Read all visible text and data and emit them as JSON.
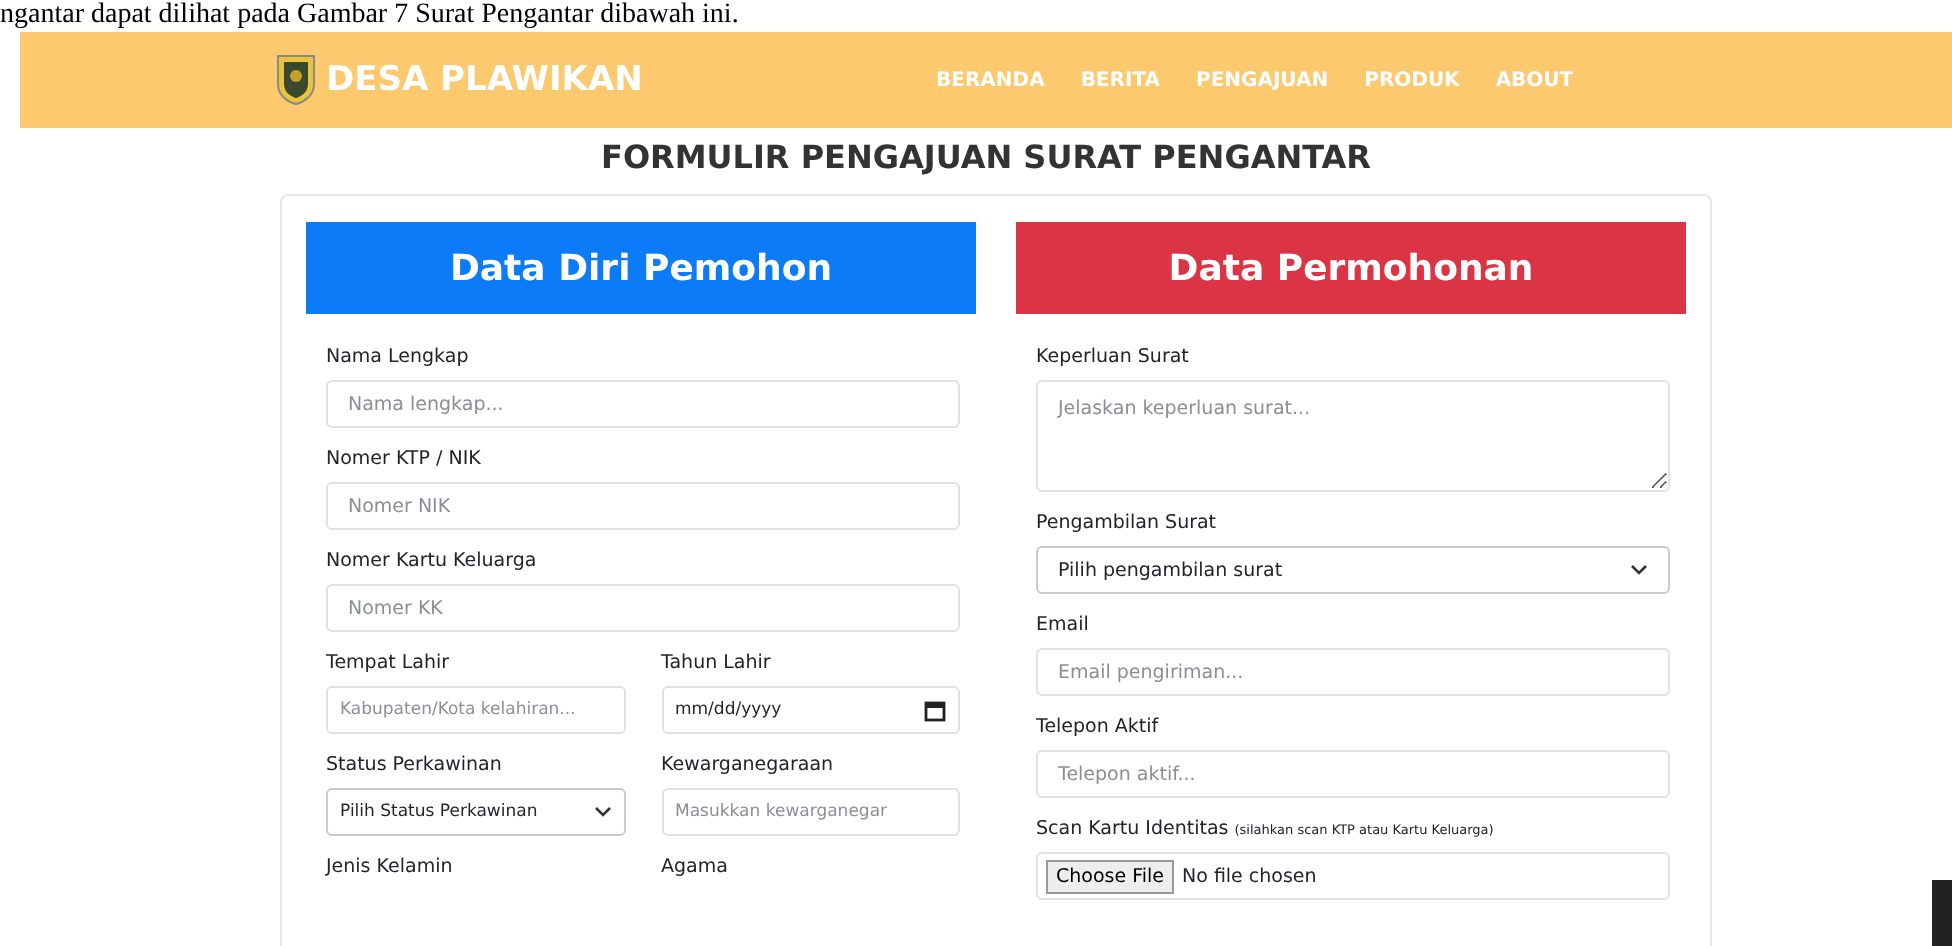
{
  "doc_caption": "ngantar dapat dilihat pada Gambar 7 Surat Pengantar dibawah ini.",
  "navbar": {
    "brand": "DESA PLAWIKAN",
    "links": [
      "BERANDA",
      "BERITA",
      "PENGAJUAN",
      "PRODUK",
      "ABOUT"
    ]
  },
  "title": "FORMULIR PENGAJUAN SURAT PENGANTAR",
  "left_panel": {
    "heading": "Data Diri Pemohon",
    "rows": [
      [
        {
          "kind": "input",
          "label": "Nama Lengkap",
          "placeholder": "Nama lengkap..."
        }
      ],
      [
        {
          "kind": "input",
          "label": "Nomer KTP / NIK",
          "placeholder": "Nomer NIK"
        }
      ],
      [
        {
          "kind": "input",
          "label": "Nomer Kartu Keluarga",
          "placeholder": "Nomer KK"
        }
      ],
      [
        {
          "kind": "input",
          "label": "Tempat Lahir",
          "placeholder": "Kabupaten/Kota kelahiran..."
        },
        {
          "kind": "date",
          "label": "Tahun Lahir",
          "placeholder": "mm/dd/yyyy"
        }
      ],
      [
        {
          "kind": "select",
          "label": "Status Perkawinan",
          "value": "Pilih Status Perkawinan"
        },
        {
          "kind": "input",
          "label": "Kewarganegaraan",
          "placeholder": "Masukkan kewarganegar"
        }
      ],
      [
        {
          "kind": "label",
          "label": "Jenis Kelamin"
        },
        {
          "kind": "label",
          "label": "Agama"
        }
      ]
    ]
  },
  "right_panel": {
    "heading": "Data Permohonan",
    "rows": [
      [
        {
          "kind": "textarea",
          "label": "Keperluan Surat",
          "placeholder": "Jelaskan keperluan surat..."
        }
      ],
      [
        {
          "kind": "select",
          "label": "Pengambilan Surat",
          "value": "Pilih pengambilan surat"
        }
      ],
      [
        {
          "kind": "input",
          "label": "Email",
          "placeholder": "Email pengiriman..."
        }
      ],
      [
        {
          "kind": "input",
          "label": "Telepon Aktif",
          "placeholder": "Telepon aktif..."
        }
      ],
      [
        {
          "kind": "file",
          "label": "Scan Kartu Identitas",
          "note": "(silahkan scan KTP atau Kartu Keluarga)",
          "button": "Choose File",
          "status": "No file chosen"
        }
      ]
    ]
  }
}
